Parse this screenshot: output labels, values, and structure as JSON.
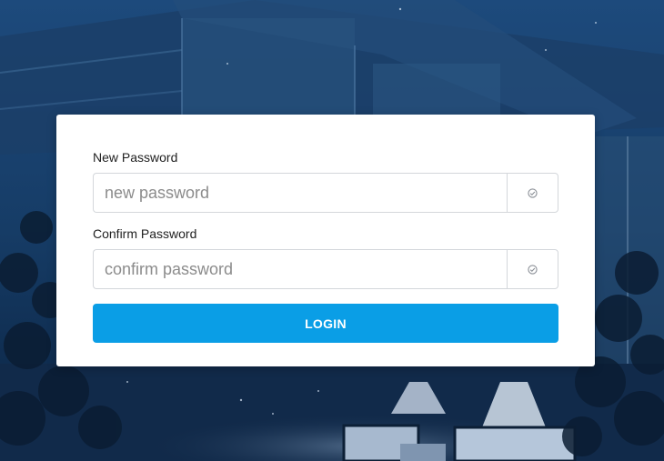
{
  "form": {
    "new_password": {
      "label": "New Password",
      "placeholder": "new password",
      "value": "",
      "addon_icon": "check-circle-icon"
    },
    "confirm_password": {
      "label": "Confirm Password",
      "placeholder": "confirm password",
      "value": "",
      "addon_icon": "check-circle-icon"
    },
    "submit_label": "LOGIN"
  },
  "colors": {
    "primary_button": "#0a9ee6",
    "card_background": "#ffffff",
    "page_background": "#0f2c4f"
  }
}
